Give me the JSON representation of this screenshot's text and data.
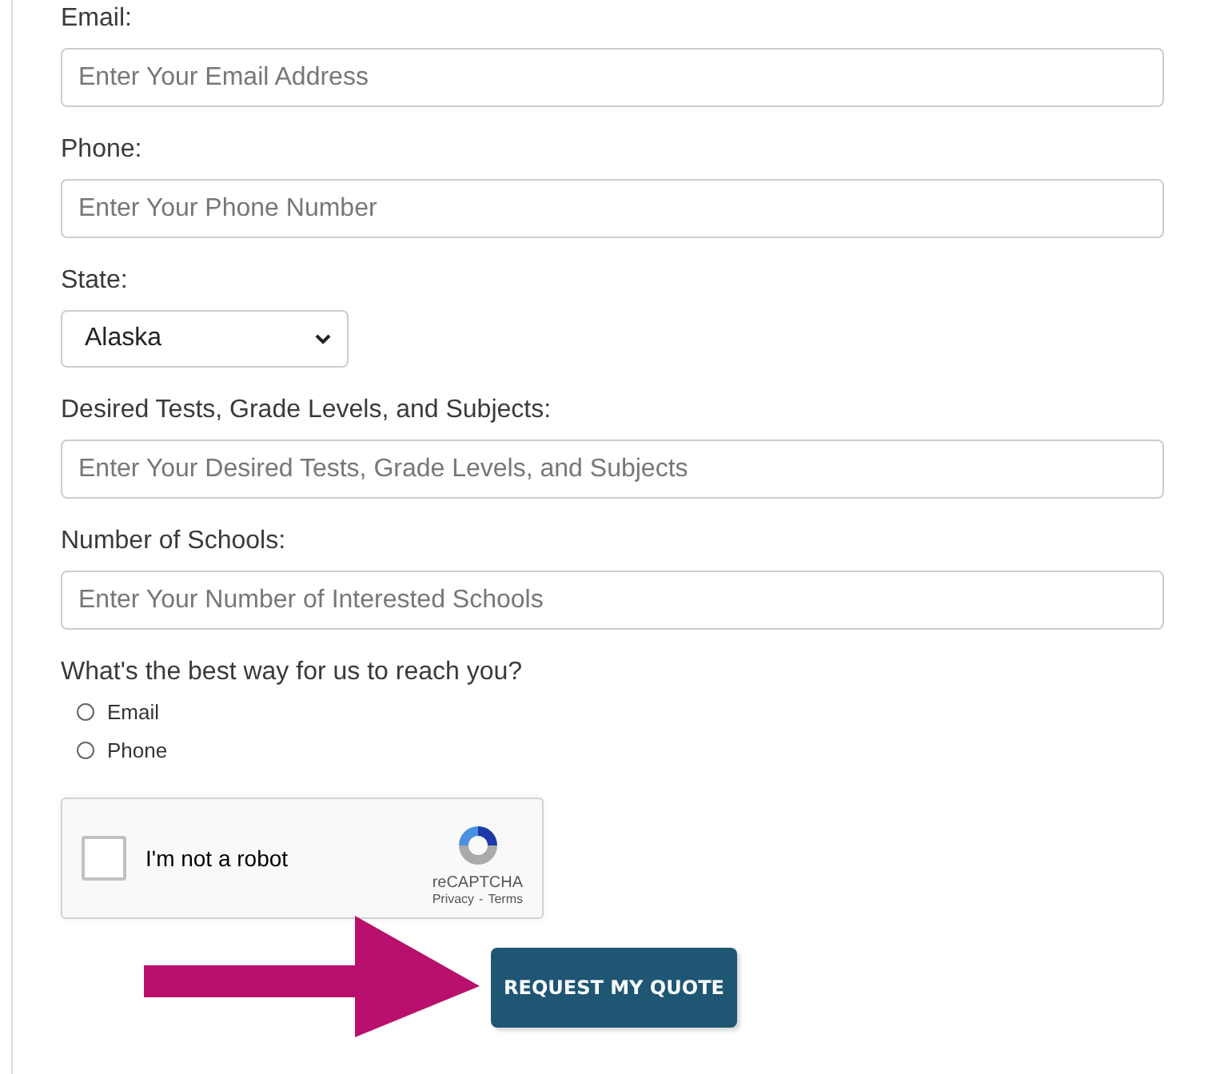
{
  "fields": [
    {
      "kind": "text",
      "label": "Email:",
      "placeholder": "Enter Your Email Address"
    },
    {
      "kind": "text",
      "label": "Phone:",
      "placeholder": "Enter Your Phone Number"
    },
    {
      "kind": "select",
      "label": "State:",
      "value": "Alaska"
    },
    {
      "kind": "text",
      "label": "Desired Tests, Grade Levels, and Subjects:",
      "placeholder": "Enter Your Desired Tests, Grade Levels, and Subjects"
    },
    {
      "kind": "text",
      "label": "Number of Schools:",
      "placeholder": "Enter Your Number of Interested Schools"
    }
  ],
  "contact": {
    "question": "What's the best way for us to reach you?",
    "options": [
      {
        "label": "Email",
        "selected": false
      },
      {
        "label": "Phone",
        "selected": false
      }
    ]
  },
  "captcha": {
    "label": "I'm not a robot",
    "checked": false,
    "brand": "reCAPTCHA",
    "links": [
      "Privacy",
      "Terms"
    ],
    "separator": "-"
  },
  "submit": "REQUEST MY QUOTE"
}
